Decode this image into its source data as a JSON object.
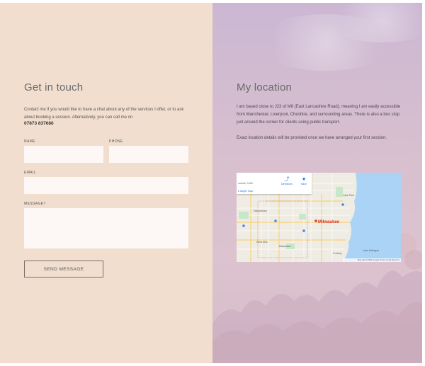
{
  "contact": {
    "title": "Get in touch",
    "intro": "Contact me if you would like to have a chat about any of the services I offer, or to ask about booking a session. Alternatively, you can call me on",
    "phone": "07873 837686",
    "fields": {
      "name_label": "NAME",
      "phone_label": "PHONE",
      "email_label": "EMAIL",
      "message_label": "MESSAGE?"
    },
    "submit_label": "SEND MESSAGE"
  },
  "location": {
    "title": "My location",
    "paragraph1": "I am based close to J23 of M6 (East Lancashire Road), meaning I am easily accessible from Manchester, Liverpool, Cheshire, and surrounding areas. There is also a bus stop just around the corner for clients using public transport.",
    "paragraph2": "Exact location details will be provided once we have arranged your first session.",
    "map": {
      "card_subtitle": "consin, USA",
      "card_link": "e larger map",
      "directions_label": "Directions",
      "save_label": "Save",
      "city_label": "Milwaukee",
      "lake_label": "Lake Michigan",
      "place_labels": [
        "Lake Park",
        "Wauwatosa",
        "West Allis",
        "Milwaukee",
        "Cudahy"
      ],
      "footer": "Map data ©2024 Google   Terms of Use   Report a"
    }
  },
  "colors": {
    "left_bg": "#f1dece",
    "right_bg": "#cbb7d3",
    "field_bg": "#fdf8f6",
    "water": "#aad3f6"
  }
}
